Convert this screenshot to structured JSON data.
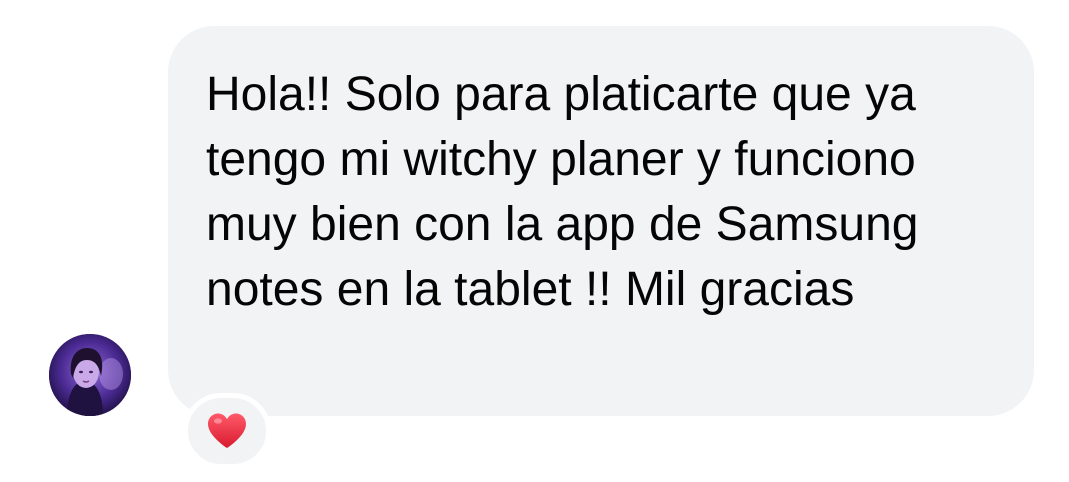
{
  "message": {
    "text": "Hola!! Solo para platicarte que ya tengo mi witchy planer y funciono muy bien con la app de Samsung notes en la tablet !! Mil gracias",
    "bubble_color": "#f2f3f5",
    "text_color": "#050505"
  },
  "sender": {
    "avatar_icon": "profile-photo"
  },
  "reaction": {
    "emoji": "❤️",
    "icon": "red-heart-icon",
    "color": "#e8263b"
  }
}
